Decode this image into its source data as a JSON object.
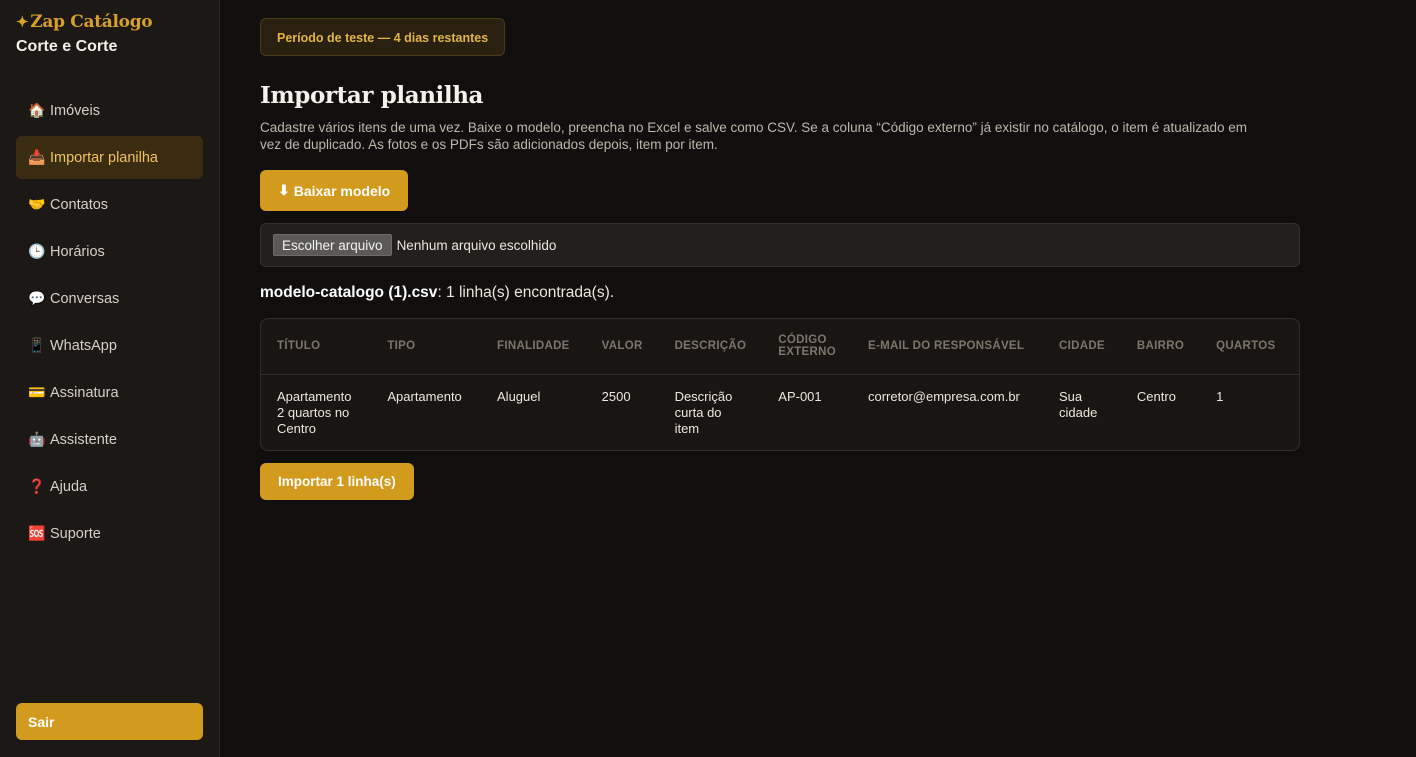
{
  "sidebar": {
    "brand_star": "✦",
    "brand": "Zap Catálogo",
    "tenant": "Corte e Corte",
    "items": [
      {
        "icon": "🏠",
        "icon_name": "house-icon",
        "label": "Imóveis"
      },
      {
        "icon": "📥",
        "icon_name": "inbox-tray-icon",
        "label": "Importar planilha"
      },
      {
        "icon": "🤝",
        "icon_name": "handshake-icon",
        "label": "Contatos"
      },
      {
        "icon": "🕒",
        "icon_name": "clock-icon",
        "label": "Horários"
      },
      {
        "icon": "💬",
        "icon_name": "speech-bubble-icon",
        "label": "Conversas"
      },
      {
        "icon": "📱",
        "icon_name": "mobile-phone-icon",
        "label": "WhatsApp"
      },
      {
        "icon": "💳",
        "icon_name": "credit-card-icon",
        "label": "Assinatura"
      },
      {
        "icon": "🤖",
        "icon_name": "robot-icon",
        "label": "Assistente"
      },
      {
        "icon": "❓",
        "icon_name": "question-mark-icon",
        "label": "Ajuda"
      },
      {
        "icon": "🆘",
        "icon_name": "sos-icon",
        "label": "Suporte"
      }
    ],
    "active_index": 1,
    "logout_label": "Sair"
  },
  "main": {
    "trial_banner": "Período de teste — 4 dias restantes",
    "title": "Importar planilha",
    "description": "Cadastre vários itens de uma vez. Baixe o modelo, preencha no Excel e salve como CSV. Se a coluna “Código externo” já existir no catálogo, o item é atualizado em vez de duplicado. As fotos e os PDFs são adicionados depois, item por item.",
    "download_icon": "⬇",
    "download_label": "Baixar modelo",
    "file_button_label": "Escolher arquivo",
    "file_status": "Nenhum arquivo escolhido",
    "summary_file": "modelo-catalogo (1).csv",
    "summary_text": ": 1 linha(s) encontrada(s).",
    "table": {
      "headers": [
        "TÍTULO",
        "TIPO",
        "FINALIDADE",
        "VALOR",
        "DESCRIÇÃO",
        "CÓDIGO EXTERNO",
        "E-MAIL DO RESPONSÁVEL",
        "CIDADE",
        "BAIRRO",
        "QUARTOS"
      ],
      "rows": [
        [
          "Apartamento 2 quartos no Centro",
          "Apartamento",
          "Aluguel",
          "2500",
          "Descrição curta do item",
          "AP-001",
          "corretor@empresa.com.br",
          "Sua cidade",
          "Centro",
          "1"
        ]
      ]
    },
    "import_label": "Importar 1 linha(s)"
  },
  "colors": {
    "accent": "#d39b1d",
    "active_bg": "#3a2c10",
    "background": "#110f0e",
    "sidebar_bg": "#1b1816"
  }
}
